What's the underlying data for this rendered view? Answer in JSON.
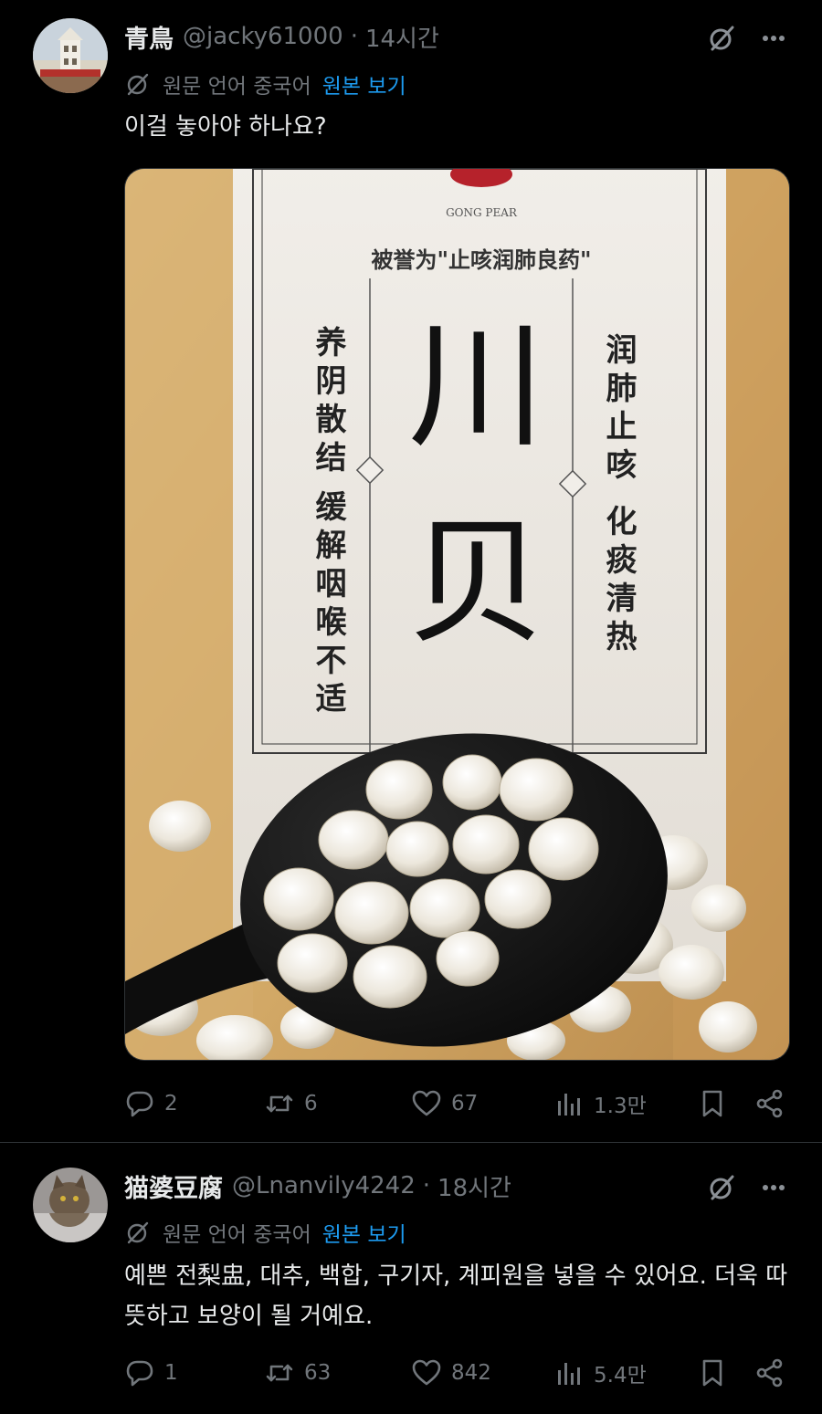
{
  "posts": [
    {
      "display_name": "青鳥",
      "handle": "@jacky61000",
      "dot": "·",
      "time": "14시간",
      "translate_label": "원문 언어 중국어",
      "translate_link": "원본 보기",
      "text": "이걸 놓아야 하나요?",
      "media": {
        "brand_line": "GONG PEAR",
        "slogan": "被誉为\"止咳润肺良药\"",
        "title_top": "川",
        "title_bottom": "贝",
        "left_col_1": "养阴散结",
        "left_col_2": "缓解咽喉不适",
        "right_col_1": "润肺止咳",
        "right_col_2": "化痰清热"
      },
      "actions": {
        "replies": "2",
        "reposts": "6",
        "likes": "67",
        "views": "1.3만"
      }
    },
    {
      "display_name": "猫婆豆腐",
      "handle": "@Lnanvily4242",
      "dot": "·",
      "time": "18시간",
      "translate_label": "원문 언어 중국어",
      "translate_link": "원본 보기",
      "text": "예쁜 전梨盅, 대추, 백합, 구기자, 계피원을 넣을 수 있어요. 더욱 따뜻하고 보양이 될 거예요.",
      "actions": {
        "replies": "1",
        "reposts": "63",
        "likes": "842",
        "views": "5.4만"
      }
    }
  ],
  "colors": {
    "background": "#000000",
    "text": "#e7e9ea",
    "muted": "#71767b",
    "link": "#1d9bf0",
    "divider": "#2f3336"
  },
  "icons": [
    "grok-icon",
    "more-icon",
    "translate-icon",
    "reply-icon",
    "repost-icon",
    "like-icon",
    "views-icon",
    "bookmark-icon",
    "share-icon"
  ]
}
